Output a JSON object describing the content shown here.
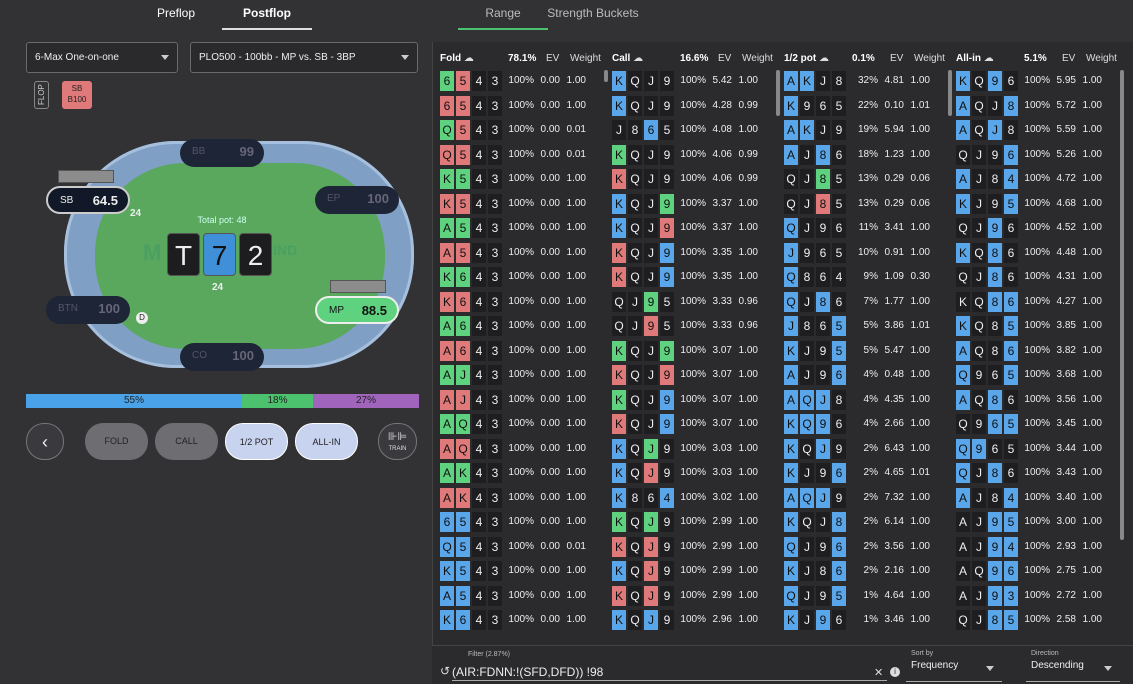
{
  "nav": {
    "tabs": [
      "Preflop",
      "Postflop"
    ],
    "right_tabs": [
      "Range",
      "Strength Buckets"
    ]
  },
  "dropdowns": {
    "game": "6-Max One-on-one",
    "spot": "PLO500 - 100bb - MP vs. SB - 3BP"
  },
  "badges": {
    "street": "FLOP",
    "action_line1": "SB",
    "action_line2": "B100"
  },
  "table": {
    "total_pot_label": "Total pot: 48",
    "pot_amount": "24",
    "sb_bet": "24",
    "board": [
      "T",
      "7",
      "2"
    ],
    "seats": {
      "bb": {
        "name": "BB",
        "stack": "99"
      },
      "sb": {
        "name": "SB",
        "stack": "64.5"
      },
      "ep": {
        "name": "EP",
        "stack": "100"
      },
      "btn": {
        "name": "BTN",
        "stack": "100"
      },
      "mp": {
        "name": "MP",
        "stack": "88.5"
      },
      "co": {
        "name": "CO",
        "stack": "100"
      }
    },
    "dealer": "D",
    "logo_text": "IND"
  },
  "freq_bar": [
    {
      "label": "55%",
      "value": 55,
      "color": "#4aa3e8"
    },
    {
      "label": "18%",
      "value": 18,
      "color": "#4cc26e"
    },
    {
      "label": "27%",
      "value": 27,
      "color": "#a064bc"
    }
  ],
  "actions": {
    "back": "‹",
    "fold": "FOLD",
    "call": "CALL",
    "half_pot": "1/2 POT",
    "allin": "ALL-IN",
    "train": "TRAIN"
  },
  "columns": [
    {
      "title": "Fold",
      "freq": "78.1%",
      "ev": "EV",
      "weight": "Weight",
      "rows": [
        [
          "65 43",
          "gr",
          "100%",
          "0.00",
          "1.00"
        ],
        [
          "65 43",
          "rr",
          "100%",
          "0.00",
          "1.00"
        ],
        [
          "Q5 43",
          "gr",
          "100%",
          "0.00",
          "0.01"
        ],
        [
          "Q5 43",
          "rr",
          "100%",
          "0.00",
          "0.01"
        ],
        [
          "K5 43",
          "gg",
          "100%",
          "0.00",
          "1.00"
        ],
        [
          "K5 43",
          "rr",
          "100%",
          "0.00",
          "1.00"
        ],
        [
          "A5 43",
          "gg",
          "100%",
          "0.00",
          "1.00"
        ],
        [
          "A5 43",
          "rr",
          "100%",
          "0.00",
          "1.00"
        ],
        [
          "K6 43",
          "gg",
          "100%",
          "0.00",
          "1.00"
        ],
        [
          "K6 43",
          "rr",
          "100%",
          "0.00",
          "1.00"
        ],
        [
          "A6 43",
          "gg",
          "100%",
          "0.00",
          "1.00"
        ],
        [
          "A6 43",
          "rr",
          "100%",
          "0.00",
          "1.00"
        ],
        [
          "AJ 43",
          "gg",
          "100%",
          "0.00",
          "1.00"
        ],
        [
          "AJ 43",
          "rr",
          "100%",
          "0.00",
          "1.00"
        ],
        [
          "AQ 43",
          "gg",
          "100%",
          "0.00",
          "1.00"
        ],
        [
          "AQ 43",
          "rr",
          "100%",
          "0.00",
          "1.00"
        ],
        [
          "AK 43",
          "gg",
          "100%",
          "0.00",
          "1.00"
        ],
        [
          "AK 43",
          "rr",
          "100%",
          "0.00",
          "1.00"
        ],
        [
          "65 43",
          "bb",
          "100%",
          "0.00",
          "1.00"
        ],
        [
          "Q5 43",
          "bb",
          "100%",
          "0.00",
          "0.01"
        ],
        [
          "K5 43",
          "bb",
          "100%",
          "0.00",
          "1.00"
        ],
        [
          "A5 43",
          "bb",
          "100%",
          "0.00",
          "1.00"
        ],
        [
          "K6 43",
          "bb",
          "100%",
          "0.00",
          "1.00"
        ]
      ]
    },
    {
      "title": "Call",
      "freq": "16.6%",
      "ev": "EV",
      "weight": "Weight",
      "rows": [
        [
          "KQJ9",
          "bkkk",
          "100%",
          "5.42",
          "1.00"
        ],
        [
          "KQJ9",
          "bkkk",
          "100%",
          "4.28",
          "0.99"
        ],
        [
          "J865",
          "kkbk",
          "100%",
          "4.08",
          "1.00"
        ],
        [
          "KQJ9",
          "gkkk",
          "100%",
          "4.06",
          "0.99"
        ],
        [
          "KQJ9",
          "rkkk",
          "100%",
          "4.06",
          "0.99"
        ],
        [
          "KQJ9",
          "bkkg",
          "100%",
          "3.37",
          "1.00"
        ],
        [
          "KQJ9",
          "bkkr",
          "100%",
          "3.37",
          "1.00"
        ],
        [
          "KQJ9",
          "rkkb",
          "100%",
          "3.35",
          "1.00"
        ],
        [
          "KQJ9",
          "rkkb",
          "100%",
          "3.35",
          "1.00"
        ],
        [
          "QJ95",
          "kkgk",
          "100%",
          "3.33",
          "0.96"
        ],
        [
          "QJ95",
          "kkrk",
          "100%",
          "3.33",
          "0.96"
        ],
        [
          "KQJ9",
          "gkkg",
          "100%",
          "3.07",
          "1.00"
        ],
        [
          "KQJ9",
          "rkkr",
          "100%",
          "3.07",
          "1.00"
        ],
        [
          "KQJ9",
          "gkkb",
          "100%",
          "3.07",
          "1.00"
        ],
        [
          "KQJ9",
          "rkkb",
          "100%",
          "3.07",
          "1.00"
        ],
        [
          "KQJ9",
          "bkgk",
          "100%",
          "3.03",
          "1.00"
        ],
        [
          "KQJ9",
          "bkrk",
          "100%",
          "3.03",
          "1.00"
        ],
        [
          "K864",
          "bkkb",
          "100%",
          "3.02",
          "1.00"
        ],
        [
          "KQJ9",
          "gkgk",
          "100%",
          "2.99",
          "1.00"
        ],
        [
          "KQJ9",
          "rkrk",
          "100%",
          "2.99",
          "1.00"
        ],
        [
          "KQJ9",
          "bkrk",
          "100%",
          "2.99",
          "1.00"
        ],
        [
          "KQJ9",
          "rkrk",
          "100%",
          "2.99",
          "1.00"
        ],
        [
          "KQJ9",
          "bkbk",
          "100%",
          "2.96",
          "1.00"
        ]
      ]
    },
    {
      "title": "1/2 pot",
      "freq": "0.1%",
      "ev": "EV",
      "weight": "Weight",
      "rows": [
        [
          "AKJ8",
          "bbkk",
          "32%",
          "4.81",
          "1.00"
        ],
        [
          "K965",
          "bkkk",
          "22%",
          "0.10",
          "1.01"
        ],
        [
          "AKJ9",
          "bbkk",
          "19%",
          "5.94",
          "1.00"
        ],
        [
          "AJ86",
          "bkbk",
          "18%",
          "1.23",
          "1.00"
        ],
        [
          "QJ85",
          "kkgk",
          "13%",
          "0.29",
          "0.06"
        ],
        [
          "QJ85",
          "kkrk",
          "13%",
          "0.29",
          "0.06"
        ],
        [
          "QJ96",
          "bkkk",
          "11%",
          "3.41",
          "1.00"
        ],
        [
          "J965",
          "bkkk",
          "10%",
          "0.91",
          "1.00"
        ],
        [
          "Q864",
          "bkkk",
          "9%",
          "1.09",
          "0.30"
        ],
        [
          "QJ86",
          "bkbk",
          "7%",
          "1.77",
          "1.00"
        ],
        [
          "J865",
          "bkkb",
          "5%",
          "3.86",
          "1.01"
        ],
        [
          "KJ95",
          "bkkb",
          "5%",
          "5.47",
          "1.00"
        ],
        [
          "AJ96",
          "bkkb",
          "4%",
          "0.48",
          "1.00"
        ],
        [
          "AQJ8",
          "bbbk",
          "4%",
          "4.35",
          "1.00"
        ],
        [
          "KQ96",
          "bbbk",
          "4%",
          "2.66",
          "1.00"
        ],
        [
          "KQJ9",
          "bkbk",
          "2%",
          "6.43",
          "1.00"
        ],
        [
          "KJ96",
          "bkkb",
          "2%",
          "4.65",
          "1.01"
        ],
        [
          "AQJ9",
          "bbbk",
          "2%",
          "7.32",
          "1.00"
        ],
        [
          "KQJ8",
          "bkkb",
          "2%",
          "6.14",
          "1.00"
        ],
        [
          "QJ96",
          "bkkb",
          "2%",
          "3.56",
          "1.00"
        ],
        [
          "KJ86",
          "bkkb",
          "2%",
          "2.16",
          "1.00"
        ],
        [
          "QJ95",
          "bkkb",
          "1%",
          "4.64",
          "1.00"
        ],
        [
          "KJ96",
          "bkbk",
          "1%",
          "3.46",
          "1.00"
        ]
      ]
    },
    {
      "title": "All-in",
      "freq": "5.1%",
      "ev": "EV",
      "weight": "Weight",
      "rows": [
        [
          "KQ96",
          "bkbk",
          "100%",
          "5.95",
          "1.00"
        ],
        [
          "AQJ8",
          "bkkb",
          "100%",
          "5.72",
          "1.00"
        ],
        [
          "AQJ8",
          "bkbk",
          "100%",
          "5.59",
          "1.00"
        ],
        [
          "QJ96",
          "kkkb",
          "100%",
          "5.26",
          "1.00"
        ],
        [
          "AJ84",
          "bkkb",
          "100%",
          "4.72",
          "1.00"
        ],
        [
          "KJ95",
          "bkkb",
          "100%",
          "4.68",
          "1.00"
        ],
        [
          "QJ96",
          "kkbk",
          "100%",
          "4.52",
          "1.00"
        ],
        [
          "KQ86",
          "bkbk",
          "100%",
          "4.48",
          "1.00"
        ],
        [
          "QJ86",
          "kkbk",
          "100%",
          "4.31",
          "1.00"
        ],
        [
          "KQ86",
          "kkbb",
          "100%",
          "4.27",
          "1.00"
        ],
        [
          "KQ85",
          "bkkb",
          "100%",
          "3.85",
          "1.00"
        ],
        [
          "AQ86",
          "bkkb",
          "100%",
          "3.82",
          "1.00"
        ],
        [
          "Q965",
          "bkkb",
          "100%",
          "3.68",
          "1.00"
        ],
        [
          "AQ86",
          "bkbk",
          "100%",
          "3.56",
          "1.00"
        ],
        [
          "Q965",
          "kkbb",
          "100%",
          "3.45",
          "1.00"
        ],
        [
          "Q965",
          "bbkk",
          "100%",
          "3.44",
          "1.00"
        ],
        [
          "QJ86",
          "bkbk",
          "100%",
          "3.43",
          "1.00"
        ],
        [
          "AJ84",
          "bkkb",
          "100%",
          "3.40",
          "1.00"
        ],
        [
          "AJ95",
          "kkbb",
          "100%",
          "3.00",
          "1.00"
        ],
        [
          "AJ94",
          "kkbb",
          "100%",
          "2.93",
          "1.00"
        ],
        [
          "AQ96",
          "kkbb",
          "100%",
          "2.75",
          "1.00"
        ],
        [
          "AJ93",
          "kkbb",
          "100%",
          "2.72",
          "1.00"
        ],
        [
          "QJ85",
          "kkbb",
          "100%",
          "2.58",
          "1.00"
        ]
      ]
    }
  ],
  "filter": {
    "label": "Filter (2.87%)",
    "value": "(AIR:FDNN:!(SFD,DFD))  !98",
    "sort_label": "Sort by",
    "sort_value": "Frequency",
    "dir_label": "Direction",
    "dir_value": "Descending"
  },
  "colors": {
    "red": "#e07a7a",
    "blue": "#5aa6ea",
    "green": "#5fd27f",
    "dark": "#1e1e21"
  }
}
